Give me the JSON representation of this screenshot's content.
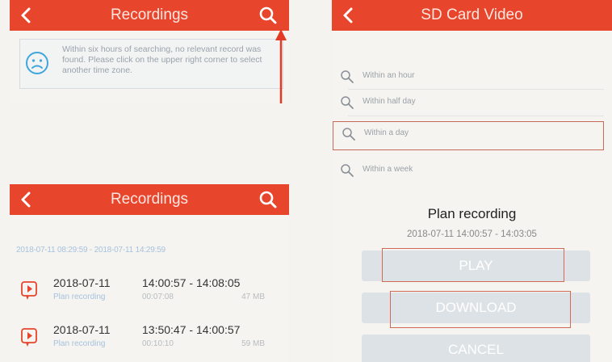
{
  "panel_recordings_empty": {
    "title": "Recordings",
    "message": "Within six hours of searching, no relevant record was found. Please click on the upper right corner to select another time zone."
  },
  "panel_sd_card": {
    "title": "SD Card Video",
    "options": [
      {
        "label": "Within an hour"
      },
      {
        "label": "Within half day"
      },
      {
        "label": "Within a day"
      },
      {
        "label": "Within a week"
      }
    ],
    "plan_title": "Plan recording",
    "plan_time": "2018-07-11   14:00:57 - 14:03:05",
    "buttons": {
      "play": "PLAY",
      "download": "DOWNLOAD",
      "cancel": "CANCEL"
    }
  },
  "panel_recordings_list": {
    "title": "Recordings",
    "range": "2018-07-11 08:29:59 - 2018-07-11 14:29:59",
    "records": [
      {
        "date": "2018-07-11",
        "time": "14:00:57 - 14:08:05",
        "type": "Plan recording",
        "duration": "00:07:08",
        "size": "47 MB"
      },
      {
        "date": "2018-07-11",
        "time": "13:50:47 - 14:00:57",
        "type": "Plan recording",
        "duration": "00:10:10",
        "size": "59 MB"
      }
    ]
  },
  "colors": {
    "header": "#e8452d",
    "highlight": "#d06a55",
    "button": "#dde2e6"
  }
}
